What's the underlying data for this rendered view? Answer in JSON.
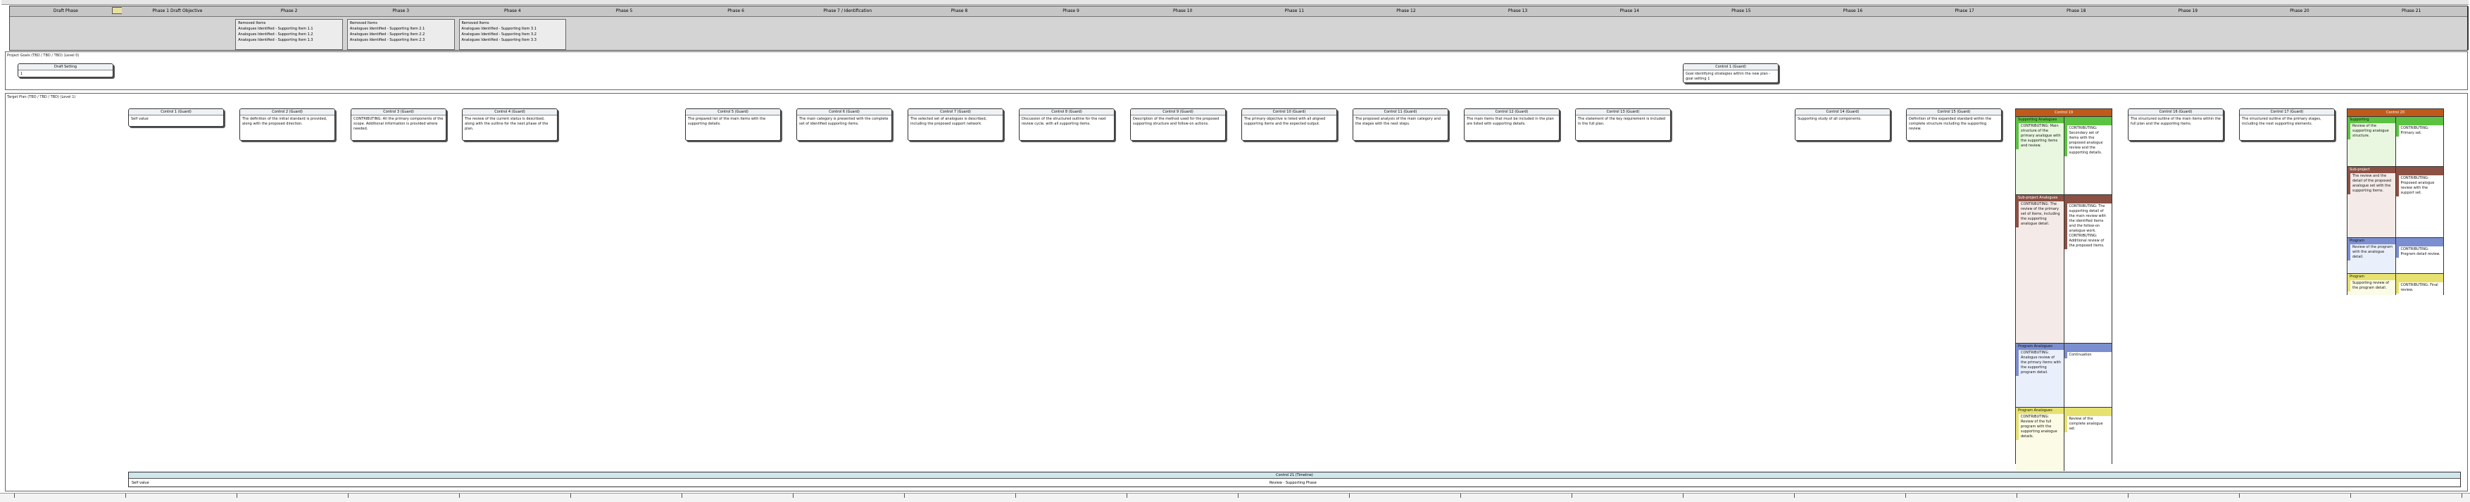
{
  "phases": [
    {
      "label": "Draft Phase",
      "card": ""
    },
    {
      "label": "Phase 1 Draft Objective",
      "card": ""
    },
    {
      "label": "Phase 2",
      "card": "Removed Items\nAnalogues Identified - Supporting Item 1.1\nAnalogues Identified - Supporting Item 1.2\nAnalogues Identified - Supporting Item 1.3"
    },
    {
      "label": "Phase 3",
      "card": "Removed Items\nAnalogues Identified - Supporting Item 2.1\nAnalogues Identified - Supporting Item 2.2\nAnalogues Identified - Supporting Item 2.3"
    },
    {
      "label": "Phase 4",
      "card": "Removed Items\nAnalogues Identified - Supporting Item 3.1\nAnalogues Identified - Supporting Item 3.2\nAnalogues Identified - Supporting Item 3.3"
    },
    {
      "label": "Phase 5",
      "card": ""
    },
    {
      "label": "Phase 6",
      "card": ""
    },
    {
      "label": "Phase 7 / Identification",
      "card": ""
    },
    {
      "label": "Phase 8",
      "card": ""
    },
    {
      "label": "Phase 9",
      "card": ""
    },
    {
      "label": "Phase 10",
      "card": ""
    },
    {
      "label": "Phase 11",
      "card": ""
    },
    {
      "label": "Phase 12",
      "card": ""
    },
    {
      "label": "Phase 13",
      "card": ""
    },
    {
      "label": "Phase 14",
      "card": ""
    },
    {
      "label": "Phase 15",
      "card": ""
    },
    {
      "label": "Phase 16",
      "card": ""
    },
    {
      "label": "Phase 17",
      "card": ""
    },
    {
      "label": "Phase 18",
      "card": ""
    },
    {
      "label": "Phase 19",
      "card": ""
    },
    {
      "label": "Phase 20",
      "card": ""
    },
    {
      "label": "Phase 21",
      "card": ""
    }
  ],
  "lanes": {
    "top_label": "Project Goals (TBD / TBD / TBD) (Level 0)",
    "main_label": "Target Plan (TBD / TBD / TBD) (Level 1)"
  },
  "top_cards": [
    {
      "head": "Draft Setting",
      "body": "1"
    },
    {
      "head": "Control 1 (Guard)",
      "body": "Goal identifying strategies within the new plan - goal setting 1"
    }
  ],
  "cards": [
    {
      "head": "Control 1 (Guard)",
      "body": "Self value"
    },
    {
      "head": "Control 2 (Guard)",
      "body": "The definition of the initial standard is provided, along with the proposed direction."
    },
    {
      "head": "Control 3 (Guard)",
      "body": "CONTRIBUTING: All the primary components of the scope. Additional information is provided where needed."
    },
    {
      "head": "Control 4 (Guard)",
      "body": "The review of the current status is described, along with the outline for the next phase of the plan."
    },
    {
      "head": "Control 5 (Guard)",
      "body": "The prepared list of the main items with the supporting details."
    },
    {
      "head": "Control 6 (Guard)",
      "body": "The main category is presented with the complete set of identified supporting items."
    },
    {
      "head": "Control 7 (Guard)",
      "body": "The selected set of analogues is described, including the proposed support network."
    },
    {
      "head": "Control 8 (Guard)",
      "body": "Discussion of the structured outline for the next review cycle, with all supporting items."
    },
    {
      "head": "Control 9 (Guard)",
      "body": "Description of the method used for the proposed supporting structure and follow-on actions."
    },
    {
      "head": "Control 10 (Guard)",
      "body": "The primary objective is listed with all aligned supporting items and the expected output."
    },
    {
      "head": "Control 11 (Guard)",
      "body": "The proposed analysis of the main category and the stages with the next steps."
    },
    {
      "head": "Control 12 (Guard)",
      "body": "The main items that must be included in the plan are listed with supporting details."
    },
    {
      "head": "Control 13 (Guard)",
      "body": "The statement of the key requirement is included in the full plan."
    },
    {
      "head": "Control 14 (Guard)",
      "body": "Supporting study of all components."
    },
    {
      "head": "Control 15 (Guard)",
      "body": "Definition of the expanded standard within the complete structure including the supporting review."
    },
    {
      "head": "Control 16 (Guard)",
      "body": "The structured outline of the main items within the full plan and the supporting items."
    },
    {
      "head": "Control 17 (Guard)",
      "body": "The structured outline of the primary stages, including the next supporting elements."
    },
    {
      "head": "Control 18 (Guard)",
      "body": "Analysis of the summary and the proposed follow-on structure, including supporting items."
    }
  ],
  "board_a": {
    "title": "Control 19",
    "sections": [
      {
        "name": "Supporting Analogues",
        "left": "CONTRIBUTING: Main structure of the primary analogue with the supporting items and review.",
        "right": "CONTRIBUTING: Secondary set of items with the proposed analogue review and the supporting details."
      },
      {
        "name": "Sub-project Analogues",
        "left": "CONTRIBUTING: The review of the primary set of items, including the supporting analogue detail.",
        "right": "CONTRIBUTING: The supporting detail of the main review with the identified items and the follow-on analogue work. CONTRIBUTING: Additional review of the proposed items."
      },
      {
        "name": "Program Analogues",
        "left": "CONTRIBUTING: Analogue review of the primary items with the supporting program detail.",
        "right": "Continuation"
      },
      {
        "name": "Program Analogues",
        "left": "CONTRIBUTING: Review of the full program with the supporting analogue details.",
        "right": "Review of the complete analogue set."
      }
    ]
  },
  "board_b": {
    "title": "Control 20",
    "sections": [
      {
        "name": "Supporting",
        "left": "Review of the supporting analogue structure.",
        "right": "CONTRIBUTING: Primary set."
      },
      {
        "name": "Sub-project",
        "left": "The review and the detail of the proposed analogue set with the supporting items.",
        "right": "CONTRIBUTING: Proposed analogue review with the support set."
      },
      {
        "name": "Program",
        "left": "Review of the program with the analogue detail.",
        "right": "CONTRIBUTING: Program detail review."
      },
      {
        "name": "Program",
        "left": "Supporting review of the program detail.",
        "right": "CONTRIBUTING: Final review."
      }
    ]
  },
  "timeline": {
    "head": "Control 21 (Timeline)",
    "left": "Self value",
    "mid": "Review - Supporting Phase"
  }
}
